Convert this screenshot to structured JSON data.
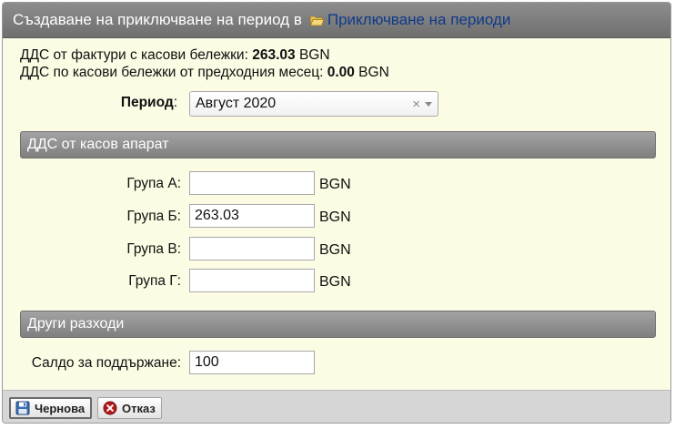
{
  "dialog": {
    "title_prefix": "Създаване на приключване на период в",
    "title_link": "Приключване на периоди"
  },
  "info": {
    "vat_invoices_label": "ДДС от фактури с касови бележки: ",
    "vat_invoices_value": "263.03",
    "vat_invoices_currency": " BGN",
    "vat_prev_label": "ДДС по касови бележки от предходния месец: ",
    "vat_prev_value": "0.00",
    "vat_prev_currency": " BGN"
  },
  "period": {
    "label": "Период",
    "label_colon": ":",
    "value": "Август 2020",
    "clear_glyph": "×"
  },
  "section_cash_register": {
    "title": "ДДС от касов апарат"
  },
  "groups": [
    {
      "label": "Група А:",
      "value": "",
      "unit": "BGN"
    },
    {
      "label": "Група Б:",
      "value": "263.03",
      "unit": "BGN"
    },
    {
      "label": "Група В:",
      "value": "",
      "unit": "BGN"
    },
    {
      "label": "Група Г:",
      "value": "",
      "unit": "BGN"
    }
  ],
  "section_other": {
    "title": "Други разходи"
  },
  "balance": {
    "label": "Салдо за поддържане:",
    "value": "100"
  },
  "footer": {
    "draft_label": "Чернова",
    "cancel_label": "Отказ"
  },
  "colors": {
    "background": "#fcfbe4",
    "header_bar": "#7f7f7f",
    "link": "#0f3a8a",
    "cancel_icon": "#b01c1c"
  }
}
